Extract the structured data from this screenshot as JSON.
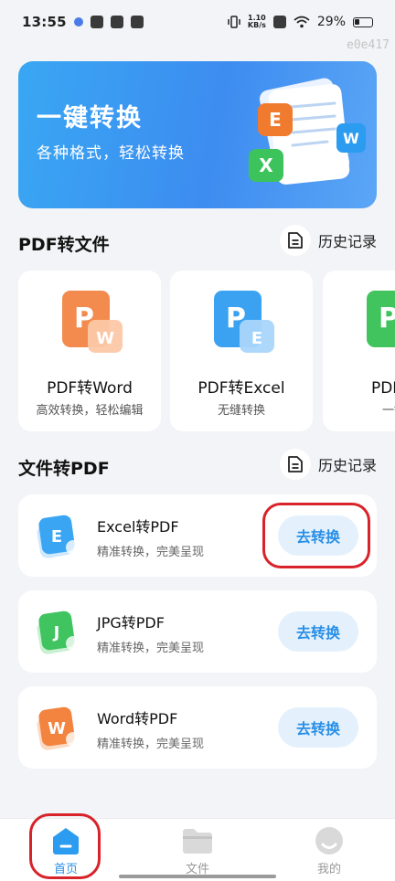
{
  "status_bar": {
    "time": "13:55",
    "net_speed_value": "1.10",
    "net_speed_unit": "KB/s",
    "battery": "29%"
  },
  "watermark": "e0e417",
  "banner": {
    "title": "一键转换",
    "subtitle": "各种格式，轻松转换",
    "badges": [
      "E",
      "W",
      "X"
    ]
  },
  "pdf_to_file": {
    "title": "PDF转文件",
    "history_label": "历史记录",
    "cards": [
      {
        "name": "PDF转Word",
        "desc": "高效转换，轻松编辑",
        "letter": "P",
        "sub_letter": "W",
        "color": "#f27a3a"
      },
      {
        "name": "PDF转Excel",
        "desc": "无缝转换",
        "letter": "P",
        "sub_letter": "E",
        "color": "#2b94f0"
      },
      {
        "name": "PDF转",
        "desc": "一键",
        "letter": "P",
        "sub_letter": "",
        "color": "#3fc05a"
      }
    ]
  },
  "file_to_pdf": {
    "title": "文件转PDF",
    "history_label": "历史记录",
    "rows": [
      {
        "title": "Excel转PDF",
        "desc": "精准转换，完美呈现",
        "button": "去转换",
        "letter": "E",
        "color": "#2b9cf0"
      },
      {
        "title": "JPG转PDF",
        "desc": "精准转换，完美呈现",
        "button": "去转换",
        "letter": "J",
        "color": "#38c25a"
      },
      {
        "title": "Word转PDF",
        "desc": "精准转换，完美呈现",
        "button": "去转换",
        "letter": "W",
        "color": "#f27a3a"
      }
    ]
  },
  "bottom_nav": {
    "items": [
      {
        "label": "首页",
        "active": true
      },
      {
        "label": "文件",
        "active": false
      },
      {
        "label": "我的",
        "active": false
      }
    ],
    "active_color": "#2a8fe6",
    "inactive_color": "#999999"
  }
}
